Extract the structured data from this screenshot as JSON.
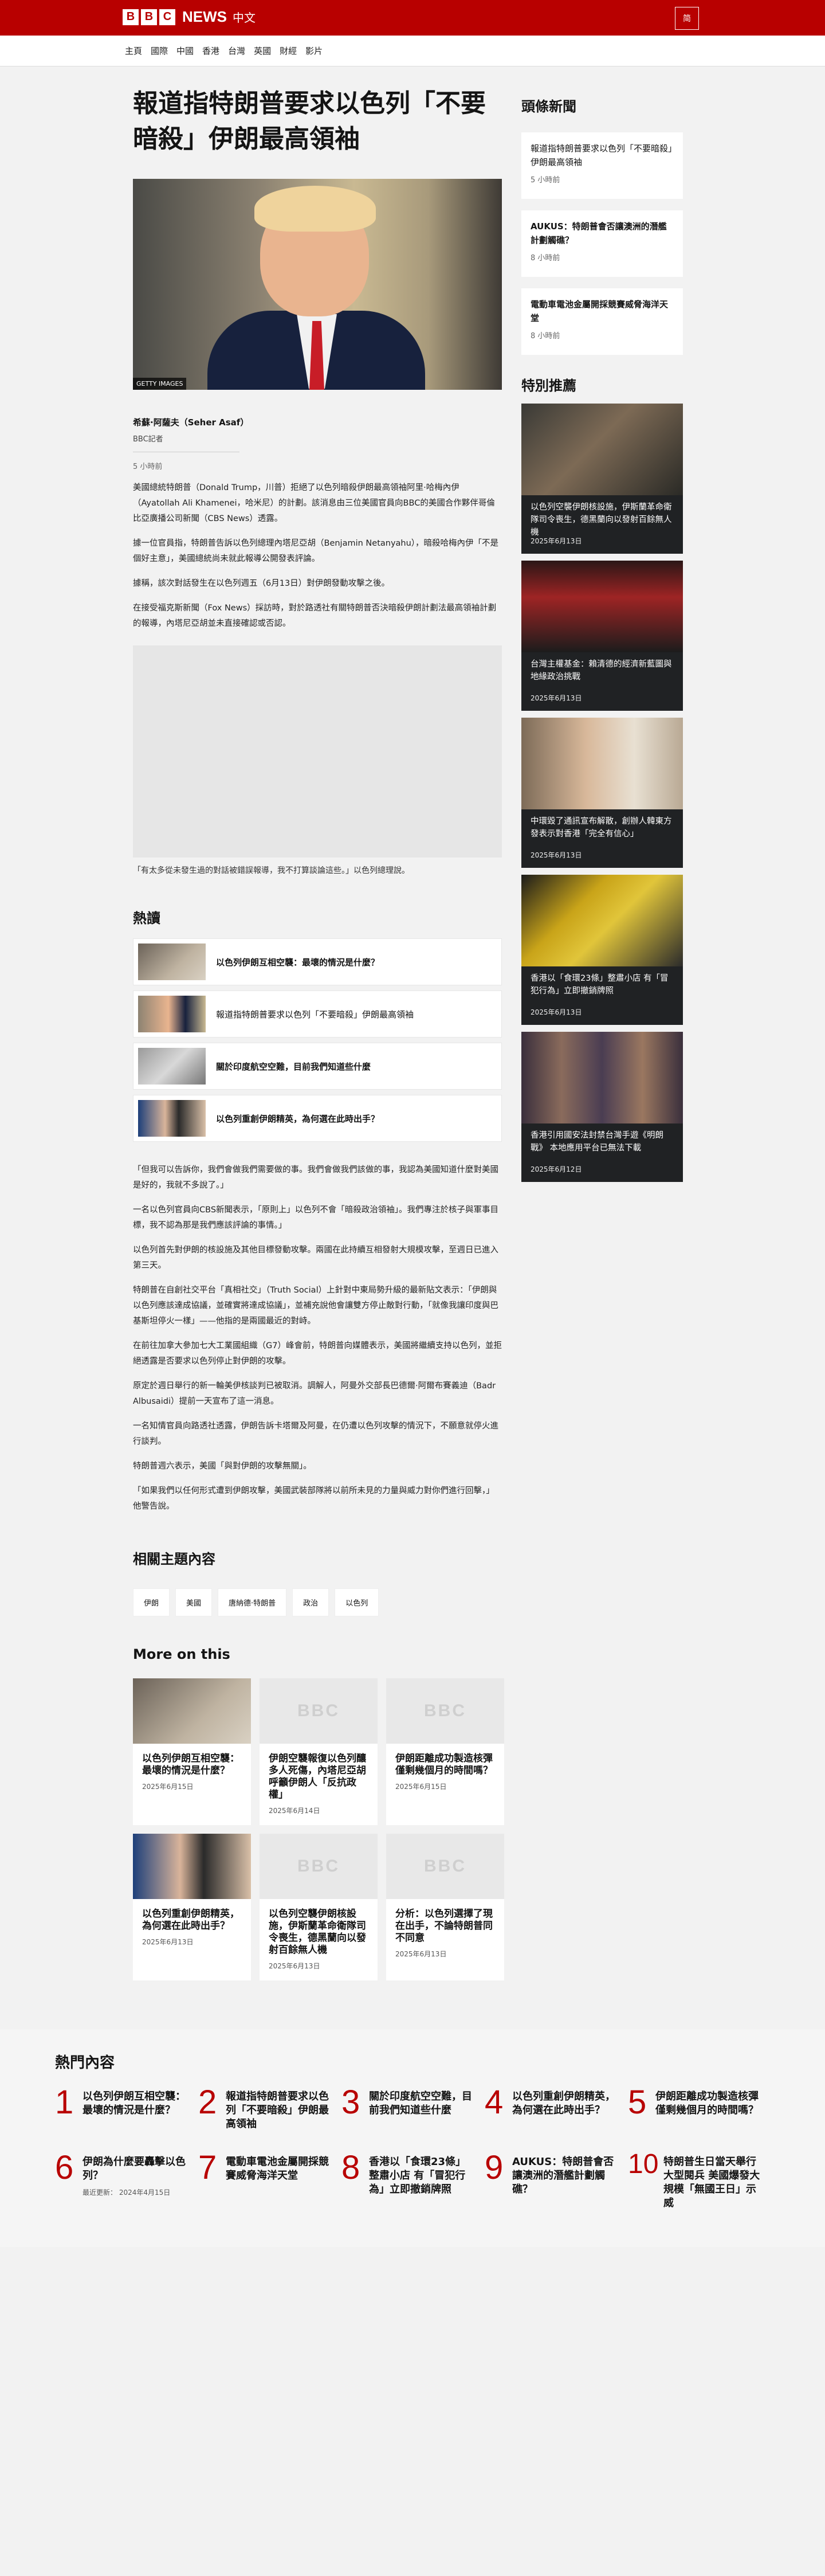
{
  "header": {
    "logo_letters": [
      "B",
      "B",
      "C"
    ],
    "news": "NEWS",
    "lang": "中文",
    "menu_label": "简"
  },
  "nav": [
    "主頁",
    "國際",
    "中國",
    "香港",
    "台灣",
    "英國",
    "財經",
    "影片"
  ],
  "article": {
    "headline": "報道指特朗普要求以色列「不要暗殺」伊朗最高領袖",
    "image_credit": "GETTY IMAGES",
    "author": "希蘇·阿薩夫（Seher Asaf）",
    "role": "BBC記者",
    "time": "5 小時前",
    "paragraphs": [
      "美國總統特朗普（Donald Trump，川普）拒絕了以色列暗殺伊朗最高領袖阿里·哈梅內伊（Ayatollah Ali Khamenei，哈米尼）的計劃。該消息由三位美國官員向BBC的美國合作夥伴哥倫比亞廣播公司新聞（CBS News）透露。",
      "據一位官員指，特朗普告訴以色列總理內塔尼亞胡（Benjamin Netanyahu），暗殺哈梅內伊「不是個好主意」，美國總統尚未就此報導公開發表評論。",
      "據稱，該次對話發生在以色列週五（6月13日）對伊朗發動攻擊之後。",
      "在接受福克斯新聞（Fox News）採訪時，對於路透社有關特朗普否決暗殺伊朗計劃法最高領袖計劃的報導，內塔尼亞胡並未直接確認或否認。"
    ],
    "video_caption": "「有太多從未發生過的對話被錯誤報導，我不打算談論這些。」以色列總理說。",
    "paragraphs2": [
      "「但我可以告訴你，我們會做我們需要做的事。我們會做我們該做的事，我認為美國知道什麼對美國是好的，我就不多說了。」",
      "一名以色列官員向CBS新聞表示，「原則上」以色列不會「暗殺政治領袖」。我們專注於核子與軍事目標，我不認為那是我們應該評論的事情。」",
      "以色列首先對伊朗的核設施及其他目標發動攻擊。兩國在此持續互相發射大規模攻擊，至週日已進入第三天。",
      "特朗普在自創社交平台「真相社交」（Truth Social）上針對中東局勢升級的最新貼文表示：「伊朗與以色列應該達成協議，並確實將達成協議」，並補充說他會讓雙方停止敵對行動，「就像我讓印度與巴基斯坦停火一樣」——他指的是兩國最近的對峙。",
      "在前往加拿大參加七大工業國組織（G7）峰會前，特朗普向媒體表示，美國將繼續支持以色列，並拒絕透露是否要求以色列停止對伊朗的攻擊。",
      "原定於週日舉行的新一輪美伊核談判已被取消。調解人，阿曼外交部長巴德爾·阿爾布賽義迪（Badr Albusaidi）提前一天宣布了這一消息。",
      "一名知情官員向路透社透露，伊朗告訴卡塔爾及阿曼，在仍遭以色列攻擊的情況下，不願意就停火進行談判。",
      "特朗普週六表示，美國「與對伊朗的攻擊無關」。",
      "「如果我們以任何形式遭到伊朗攻擊，美國武裝部隊將以前所未見的力量與威力對你們進行回擊，」他警告說。"
    ]
  },
  "hot": {
    "title": "熱讀",
    "items": [
      {
        "label": "以色列伊朗互相空襲：最壞的情況是什麼？",
        "bold": true
      },
      {
        "label": "報道指特朗普要求以色列「不要暗殺」伊朗最高領袖",
        "bold": false
      },
      {
        "label": "關於印度航空空難，目前我們知道些什麼",
        "bold": true
      },
      {
        "label": "以色列重創伊朗精英，為何選在此時出手？",
        "bold": true
      }
    ]
  },
  "related": {
    "title": "相關主題內容",
    "tags": [
      "伊朗",
      "美國",
      "唐納德·特朗普",
      "政治",
      "以色列"
    ]
  },
  "more": {
    "title": "More on this",
    "placeholder": "BBC",
    "items": [
      {
        "title": "以色列伊朗互相空襲：最壞的情況是什麼？",
        "date": "2025年6月15日"
      },
      {
        "title": "伊朗空襲報復以色列釀多人死傷，內塔尼亞胡呼籲伊朗人「反抗政權」",
        "date": "2025年6月14日"
      },
      {
        "title": "伊朗距離成功製造核彈僅剩幾個月的時間嗎？",
        "date": "2025年6月15日"
      },
      {
        "title": "以色列重創伊朗精英，為何選在此時出手？",
        "date": "2025年6月13日"
      },
      {
        "title": "以色列空襲伊朗核設施，伊斯蘭革命衛隊司令喪生，德黑蘭向以發射百餘無人機",
        "date": "2025年6月13日"
      },
      {
        "title": "分析：以色列選擇了現在出手，不論特朗普同不同意",
        "date": "2025年6月13日"
      }
    ]
  },
  "sidebar": {
    "headlines_title": "頭條新聞",
    "headlines": [
      {
        "title": "報道指特朗普要求以色列「不要暗殺」伊朗最高領袖",
        "time": "5 小時前",
        "bold": false
      },
      {
        "title": "AUKUS：特朗普會否讓澳洲的潛艦計劃觸礁？",
        "time": "8 小時前",
        "bold": true
      },
      {
        "title": "電動車電池金屬開採競賽威脅海洋天堂",
        "time": "8 小時前",
        "bold": true
      }
    ],
    "featured_title": "特別推薦",
    "featured": [
      {
        "title": "以色列空襲伊朗核設施，伊斯蘭革命衛隊司令喪生，德黑蘭向以發射百餘無人機",
        "date": "2025年6月13日"
      },
      {
        "title": "台灣主權基金：賴清德的經濟新藍圖與地緣政治挑戰",
        "date": "2025年6月13日"
      },
      {
        "title": "中環毀了通訊宣布解散，創辦人韓東方發表示對香港「完全有信心」",
        "date": "2025年6月13日"
      },
      {
        "title": "香港以「食環23條」整肅小店 有「冒犯行為」立即撤銷牌照",
        "date": "2025年6月13日"
      },
      {
        "title": "香港引用國安法封禁台灣手遊《明朗戰》 本地應用平台已無法下載",
        "date": "2025年6月12日"
      }
    ]
  },
  "popular": {
    "title": "熱門內容",
    "updated": "最近更新： 2024年4月15日",
    "items": [
      {
        "n": "1",
        "title": "以色列伊朗互相空襲：最壞的情況是什麼？"
      },
      {
        "n": "2",
        "title": "報道指特朗普要求以色列「不要暗殺」伊朗最高領袖"
      },
      {
        "n": "3",
        "title": "關於印度航空空難，目前我們知道些什麼"
      },
      {
        "n": "4",
        "title": "以色列重創伊朗精英，為何選在此時出手？"
      },
      {
        "n": "5",
        "title": "伊朗距離成功製造核彈僅剩幾個月的時間嗎？"
      },
      {
        "n": "6",
        "title": "伊朗為什麼要轟擊以色列？"
      },
      {
        "n": "7",
        "title": "電動車電池金屬開採競賽威脅海洋天堂"
      },
      {
        "n": "8",
        "title": "香港以「食環23條」整肅小店 有「冒犯行為」立即撤銷牌照"
      },
      {
        "n": "9",
        "title": "AUKUS：特朗普會否讓澳洲的潛艦計劃觸礁？"
      },
      {
        "n": "10",
        "title": "特朗普生日當天舉行大型閱兵 美國爆發大規模「無國王日」示威"
      }
    ]
  }
}
